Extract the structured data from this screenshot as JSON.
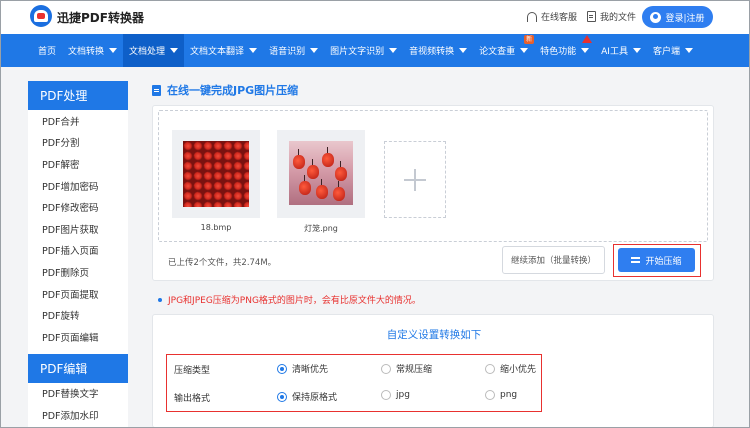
{
  "header": {
    "brand": "迅捷PDF转换器",
    "support": "在线客服",
    "my_files": "我的文件",
    "login": "登录|注册"
  },
  "nav": {
    "items": [
      {
        "label": "首页",
        "caret": false
      },
      {
        "label": "文档转换",
        "caret": true
      },
      {
        "label": "文档处理",
        "caret": true,
        "active": true
      },
      {
        "label": "文档文本翻译",
        "caret": true
      },
      {
        "label": "语音识别",
        "caret": true
      },
      {
        "label": "图片文字识别",
        "caret": true
      },
      {
        "label": "音视频转换",
        "caret": true
      },
      {
        "label": "论文查重",
        "caret": true,
        "badge": "新"
      },
      {
        "label": "特色功能",
        "caret": true
      },
      {
        "label": "AI工具",
        "caret": true
      },
      {
        "label": "客户端",
        "caret": true
      }
    ]
  },
  "sidebar": {
    "section1": "PDF处理",
    "items1": [
      "PDF合并",
      "PDF分割",
      "PDF解密",
      "PDF增加密码",
      "PDF修改密码",
      "PDF图片获取",
      "PDF插入页面",
      "PDF删除页",
      "PDF页面提取",
      "PDF旋转",
      "PDF页面编辑"
    ],
    "section2": "PDF编辑",
    "items2": [
      "PDF替换文字",
      "PDF添加水印"
    ]
  },
  "main": {
    "title": "在线一键完成JPG图片压缩",
    "files": [
      {
        "name": "18.bmp"
      },
      {
        "name": "灯笼.png"
      }
    ],
    "upload_status": "已上传2个文件，共2.74M。",
    "continue_button": "继续添加（批量转换）",
    "start_button": "开始压缩",
    "notice": "JPG和JPEG压缩为PNG格式的图片时，会有比原文件大的情况。"
  },
  "settings": {
    "title": "自定义设置转换如下",
    "rows": [
      {
        "label": "压缩类型",
        "options": [
          "清晰优先",
          "常规压缩",
          "缩小优先"
        ],
        "selected": 0
      },
      {
        "label": "输出格式",
        "options": [
          "保持原格式",
          "jpg",
          "png"
        ],
        "selected": 0
      }
    ]
  },
  "colors": {
    "primary": "#1f78e6",
    "highlight": "#e8312f"
  }
}
